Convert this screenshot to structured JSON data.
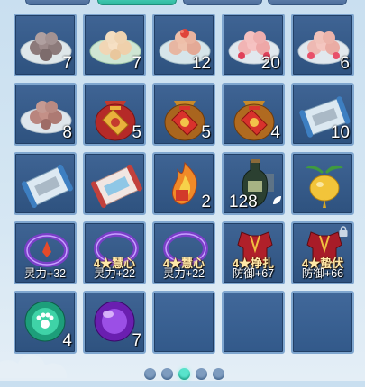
{
  "tabs": [
    {
      "name": "tab-1",
      "active": false
    },
    {
      "name": "tab-2",
      "active": true
    },
    {
      "name": "tab-3",
      "active": false
    },
    {
      "name": "tab-4",
      "active": false
    }
  ],
  "inventory": {
    "row1": [
      {
        "icon": "dumplings-gray-plate-icon",
        "count": "7"
      },
      {
        "icon": "dumplings-cream-plate-icon",
        "count": "7"
      },
      {
        "icon": "dumplings-flower-plate-icon",
        "count": "12"
      },
      {
        "icon": "dumplings-pink-plate-icon",
        "count": "20"
      },
      {
        "icon": "dumplings-pink-plate-icon",
        "count": "6"
      }
    ],
    "row2": [
      {
        "icon": "dumplings-brown-plate-icon",
        "count": "8"
      },
      {
        "icon": "lucky-bag-red-icon",
        "count": "5"
      },
      {
        "icon": "lucky-bag-gold-icon",
        "count": "5"
      },
      {
        "icon": "lucky-bag-gold-icon",
        "count": "4"
      },
      {
        "icon": "scroll-blue-icon",
        "count": "10"
      }
    ],
    "row3": [
      {
        "icon": "scroll-blue-icon",
        "count": ""
      },
      {
        "icon": "scroll-red-icon",
        "count": ""
      },
      {
        "icon": "fire-charm-icon",
        "count": "2"
      },
      {
        "icon": "wine-bottle-icon",
        "count": "128"
      },
      {
        "icon": "golden-radish-icon",
        "count": ""
      }
    ],
    "row4": [
      {
        "icon": "purple-ring-icon",
        "enh": "",
        "stat": "灵力+32",
        "locked": false
      },
      {
        "icon": "purple-ring-icon",
        "enh": "4★慧心",
        "stat": "灵力+22",
        "locked": false
      },
      {
        "icon": "purple-ring-icon",
        "enh": "4★慧心",
        "stat": "灵力+22",
        "locked": false
      },
      {
        "icon": "red-armor-icon",
        "enh": "4★挣扎",
        "stat": "防御+67",
        "locked": false
      },
      {
        "icon": "red-armor-icon",
        "enh": "4★蛰伏",
        "stat": "防御+66",
        "locked": true
      }
    ],
    "row5": [
      {
        "icon": "green-paw-orb-icon",
        "count": "4"
      },
      {
        "icon": "purple-orb-icon",
        "count": "7"
      }
    ]
  },
  "pagination": {
    "pages": 5,
    "active_index": 2
  },
  "colors": {
    "accent": "#59e3cc",
    "cell_bg": "#34598a",
    "cell_border": "#7fa6cf"
  }
}
